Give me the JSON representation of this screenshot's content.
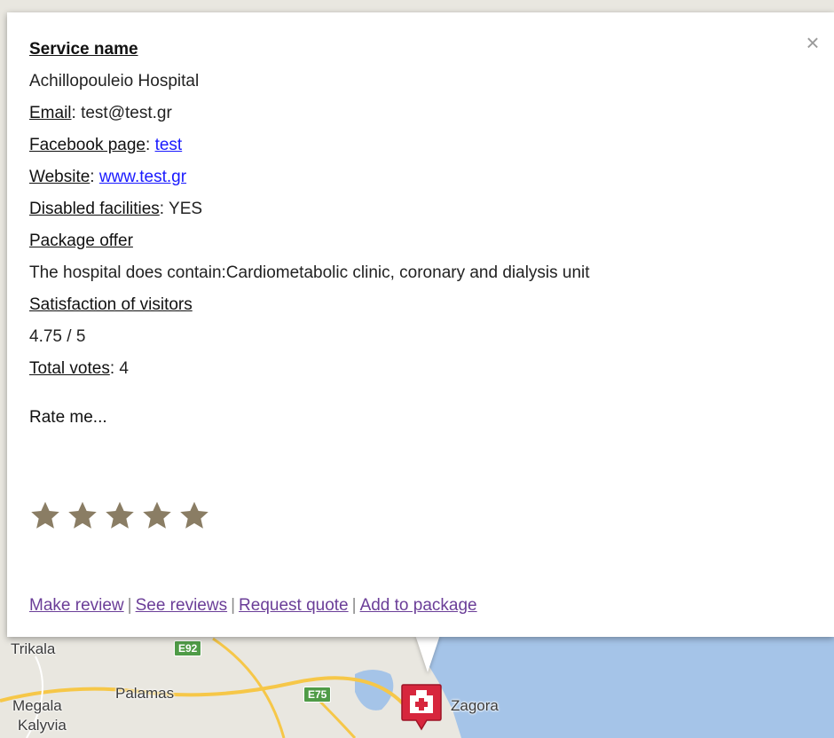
{
  "info": {
    "service_name_label": "Service name",
    "service_name": "Achillopouleio Hospital",
    "email_label": "Email",
    "email": "test@test.gr",
    "facebook_label": "Facebook page",
    "facebook": "test",
    "website_label": "Website",
    "website": "www.test.gr",
    "disabled_label": "Disabled facilities",
    "disabled": "YES",
    "package_label": "Package offer",
    "package_text": "The hospital does contain:Cardiometabolic clinic, coronary and dialysis unit",
    "satisfaction_label": "Satisfaction of visitors",
    "satisfaction": "4.75 / 5",
    "votes_label": "Total votes",
    "votes": "4",
    "rate_prompt": "Rate me...",
    "close_glyph": "×"
  },
  "rating": {
    "star_count": 5,
    "star_color": "#8a7d64"
  },
  "links": {
    "make_review": "Make review",
    "see_reviews": "See reviews",
    "request_quote": "Request quote",
    "add_to_package": "Add to package",
    "separator": "|"
  },
  "map": {
    "labels": {
      "trikala": "Trikala",
      "palamas": "Palamas",
      "megala": "Megala",
      "kalyvia": "Kalyvia",
      "zagora": "Zagora"
    },
    "shields": {
      "e92": "E92",
      "e75": "E75"
    },
    "marker_icon": "hospital-icon",
    "water_color": "#a5c4e8",
    "land_color": "#e9e7e0",
    "road_color": "#f6c748"
  }
}
